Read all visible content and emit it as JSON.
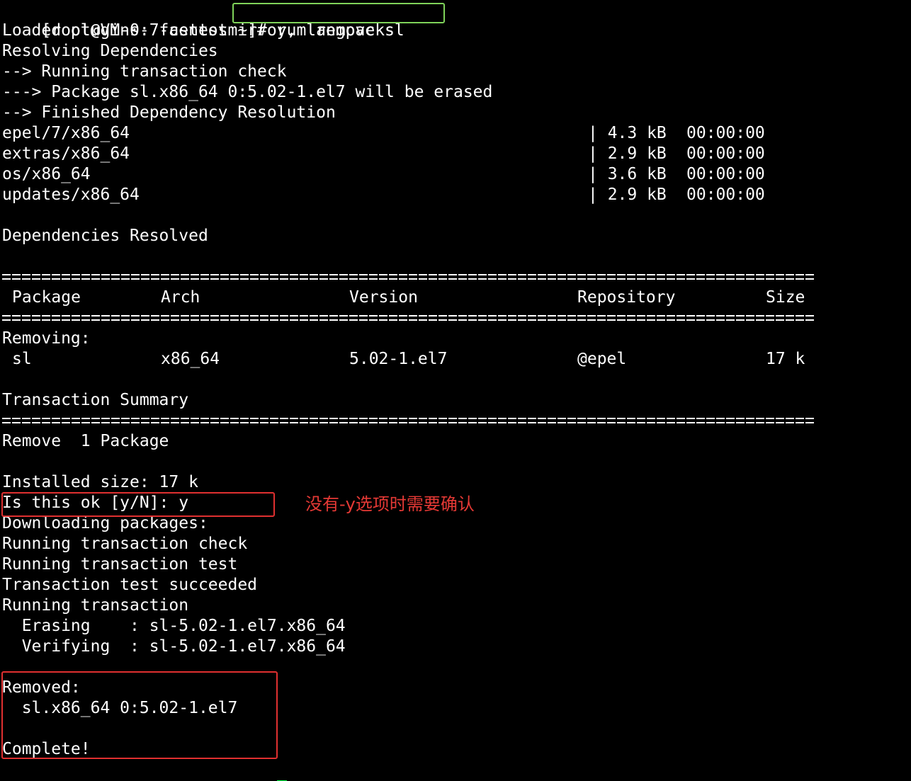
{
  "colors": {
    "background": "#000000",
    "text": "#ffffff",
    "command_highlight": "#7fd35a",
    "annotation": "#e53935",
    "cursor": "#00ff40"
  },
  "prompt": "[root@VM-0-7-centos ~]#",
  "command": "yum remove sl",
  "output": {
    "loaded_plugins": "Loaded plugins: fastestmirror, langpacks",
    "resolving": "Resolving Dependencies",
    "running_check": "--> Running transaction check",
    "package_erase": "---> Package sl.x86_64 0:5.02-1.el7 will be erased",
    "finished": "--> Finished Dependency Resolution",
    "repos": [
      {
        "name": "epel/7/x86_64",
        "size": "| 4.3 kB",
        "time": "00:00:00"
      },
      {
        "name": "extras/x86_64",
        "size": "| 2.9 kB",
        "time": "00:00:00"
      },
      {
        "name": "os/x86_64",
        "size": "| 3.6 kB",
        "time": "00:00:00"
      },
      {
        "name": "updates/x86_64",
        "size": "| 2.9 kB",
        "time": "00:00:00"
      }
    ],
    "deps_resolved": "Dependencies Resolved",
    "table": {
      "headers": [
        "Package",
        "Arch",
        "Version",
        "Repository",
        "Size"
      ],
      "section": "Removing:",
      "rows": [
        {
          "package": "sl",
          "arch": "x86_64",
          "version": "5.02-1.el7",
          "repository": "@epel",
          "size": "17 k"
        }
      ]
    },
    "transaction_summary": "Transaction Summary",
    "remove_summary": "Remove  1 Package",
    "installed_size": "Installed size: 17 k",
    "confirm_prompt": "Is this ok [y/N]: y",
    "downloading": "Downloading packages:",
    "running_check2": "Running transaction check",
    "running_test": "Running transaction test",
    "test_succeeded": "Transaction test succeeded",
    "running_transaction": "Running transaction",
    "erasing": "  Erasing    : sl-5.02-1.el7.x86_64",
    "verifying": "  Verifying  : sl-5.02-1.el7.x86_64",
    "removed_label": "Removed:",
    "removed_pkg": "  sl.x86_64 0:5.02-1.el7",
    "complete": "Complete!"
  },
  "annotation": "没有-y选项时需要确认"
}
